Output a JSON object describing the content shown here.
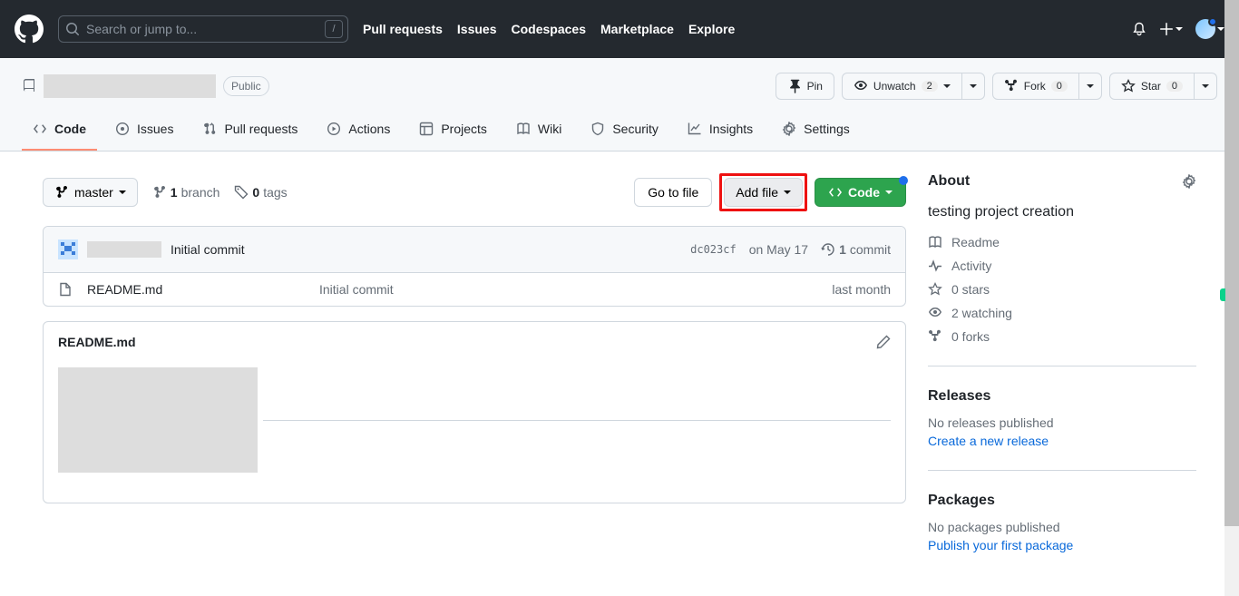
{
  "search": {
    "placeholder": "Search or jump to...",
    "slash": "/"
  },
  "topnav": [
    "Pull requests",
    "Issues",
    "Codespaces",
    "Marketplace",
    "Explore"
  ],
  "repo": {
    "visibility": "Public",
    "actions": {
      "pin": "Pin",
      "unwatch": "Unwatch",
      "watch_count": "2",
      "fork": "Fork",
      "fork_count": "0",
      "star": "Star",
      "star_count": "0"
    }
  },
  "tabs": [
    "Code",
    "Issues",
    "Pull requests",
    "Actions",
    "Projects",
    "Wiki",
    "Security",
    "Insights",
    "Settings"
  ],
  "branch": {
    "name": "master",
    "branches_count": "1",
    "branches_label": "branch",
    "tags_count": "0",
    "tags_label": "tags"
  },
  "file_actions": {
    "goto": "Go to file",
    "add": "Add file",
    "code": "Code"
  },
  "commit": {
    "message": "Initial commit",
    "hash": "dc023cf",
    "date": "on May 17",
    "count": "1",
    "count_label": "commit"
  },
  "files": [
    {
      "name": "README.md",
      "msg": "Initial commit",
      "time": "last month"
    }
  ],
  "readme": {
    "filename": "README.md"
  },
  "about": {
    "title": "About",
    "description": "testing project creation",
    "readme": "Readme",
    "activity": "Activity",
    "stars": "0 stars",
    "watching": "2 watching",
    "forks": "0 forks"
  },
  "releases": {
    "title": "Releases",
    "empty": "No releases published",
    "link": "Create a new release"
  },
  "packages": {
    "title": "Packages",
    "empty": "No packages published",
    "link": "Publish your first package"
  }
}
